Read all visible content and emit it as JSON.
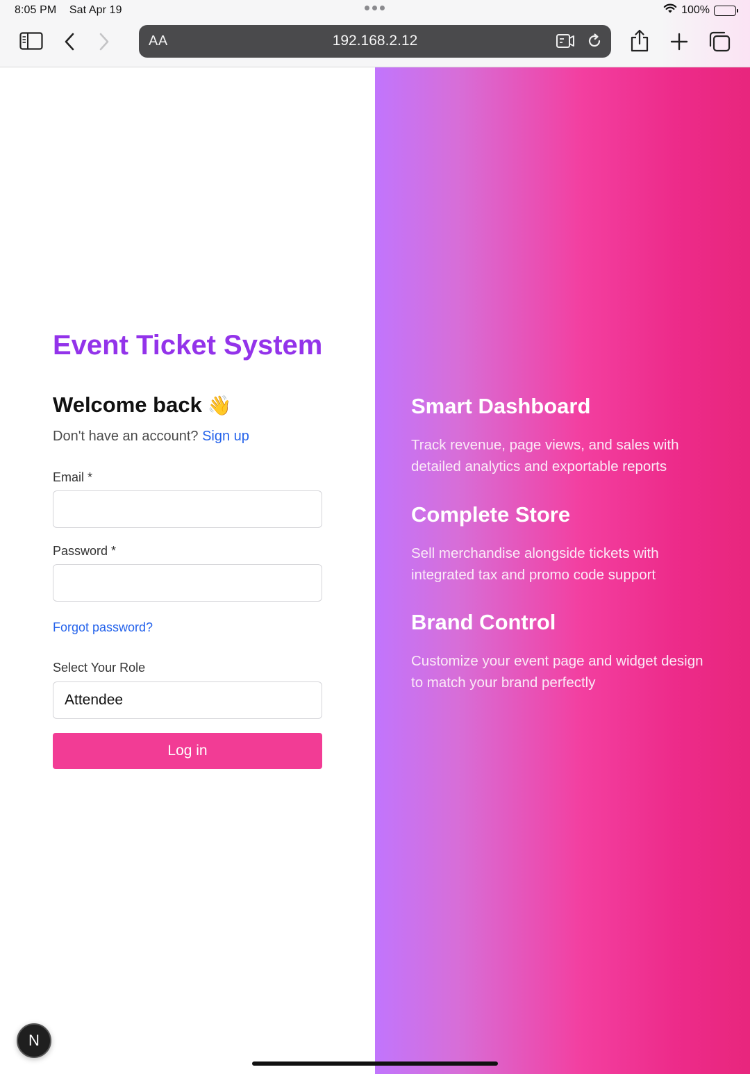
{
  "status_bar": {
    "time": "8:05 PM",
    "date": "Sat Apr 19",
    "battery_percent": "100%",
    "battery_level": 1.0
  },
  "browser": {
    "aa_label": "AA",
    "url": "192.168.2.12",
    "icons": [
      "sidebar-icon",
      "back-icon",
      "forward-icon",
      "reader-icon",
      "reload-icon",
      "share-icon",
      "new-tab-icon",
      "tabs-icon"
    ]
  },
  "login": {
    "app_title": "Event Ticket System",
    "welcome": "Welcome back",
    "welcome_emoji": "👋",
    "no_account_text": "Don't have an account?",
    "signup_link": "Sign up",
    "email_label": "Email *",
    "email_value": "",
    "password_label": "Password *",
    "password_value": "",
    "forgot_password": "Forgot password?",
    "role_label": "Select Your Role",
    "role_value": "Attendee",
    "login_button": "Log in",
    "dev_badge": "N"
  },
  "features": [
    {
      "title": "Smart Dashboard",
      "description": "Track revenue, page views, and sales with detailed analytics and exportable reports"
    },
    {
      "title": "Complete Store",
      "description": "Sell merchandise alongside tickets with integrated tax and promo code support"
    },
    {
      "title": "Brand Control",
      "description": "Customize your event page and widget design to match your brand perfectly"
    }
  ],
  "colors": {
    "title_purple": "#9333ea",
    "link_blue": "#2563eb",
    "button_pink": "#f23c95",
    "gradient_start": "#c175fd",
    "gradient_end": "#e8267d"
  }
}
